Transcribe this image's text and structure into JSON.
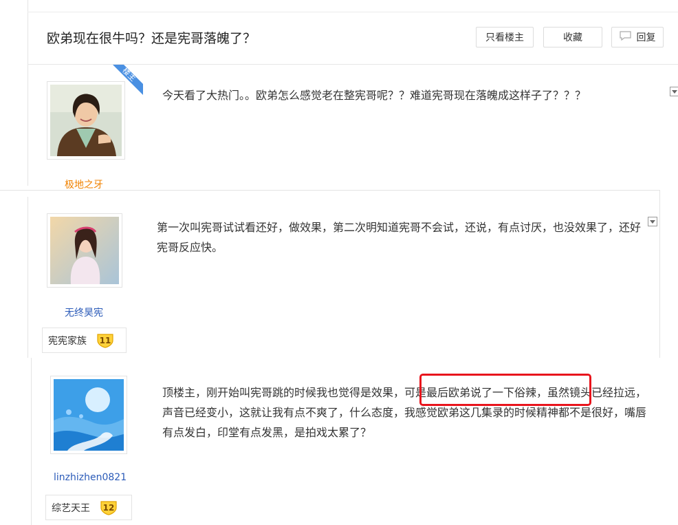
{
  "thread": {
    "title": "欧弟现在很牛吗？还是宪哥落魄了？",
    "buttons": {
      "only_op": "只看楼主",
      "favorite": "收藏",
      "reply": "回复"
    }
  },
  "posts": [
    {
      "username": "极地之牙",
      "op_badge": "楼主",
      "text": "今天看了大热门。。欧弟怎么感觉老在整宪哥呢？？难道宪哥现在落魄成这样子了？？？"
    },
    {
      "username": "无终昊宪",
      "fan_group": "宪宪家族",
      "level": "11",
      "text": "第一次叫宪哥试试看还好，做效果，第二次明知道宪哥不会试，还说，有点讨厌，也没效果了，还好宪哥反应快。"
    },
    {
      "username": "linzhizhen0821",
      "fan_group": "综艺天王",
      "level": "12",
      "text_before": "顶楼主，刚开始叫宪哥跳的时候我也觉得是效果，",
      "text_highlight": "可是最后欧弟说了一下俗辣，",
      "text_after": "虽然镜头已经拉远，声音已经变小，这就让我有点不爽了，什么态度，我感觉欧弟这几集录的时候精神都不是很好，嘴唇有点发白，印堂有点发黑，是拍戏太累了？"
    }
  ],
  "colors": {
    "op_username": "#f08200",
    "username": "#2a5ab8",
    "op_badge": "#4a90e2",
    "highlight_border": "#e8141c"
  }
}
